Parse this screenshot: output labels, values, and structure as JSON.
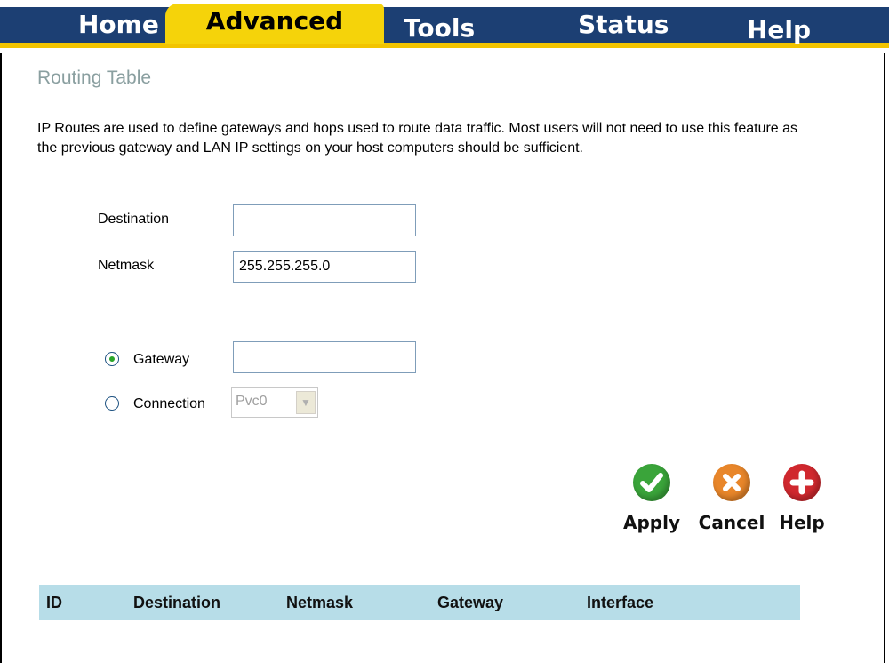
{
  "tabs": [
    {
      "label": "Home",
      "active": false
    },
    {
      "label": "Advanced",
      "active": true
    },
    {
      "label": "Tools",
      "active": false
    },
    {
      "label": "Status",
      "active": false
    },
    {
      "label": "Help",
      "active": false
    }
  ],
  "colors": {
    "nav": "#1c3f73",
    "accent": "#f5d30a",
    "table_header": "#b7dde8",
    "title": "#8a9fa0"
  },
  "page": {
    "title": "Routing Table",
    "intro": "IP Routes are used to define gateways and hops used to route data traffic. Most users will not need to use this feature as the previous gateway and LAN IP settings on your host computers should be sufficient."
  },
  "form": {
    "destination_label": "Destination",
    "destination_value": "",
    "netmask_label": "Netmask",
    "netmask_value": "255.255.255.0",
    "gateway_label": "Gateway",
    "gateway_value": "",
    "gateway_selected": true,
    "connection_label": "Connection",
    "connection_selected": false,
    "connection_value": "Pvc0"
  },
  "actions": {
    "apply": {
      "label": "Apply",
      "icon": "checkmark-icon"
    },
    "cancel": {
      "label": "Cancel",
      "icon": "x-icon"
    },
    "help": {
      "label": "Help",
      "icon": "plus-icon"
    }
  },
  "table": {
    "columns": [
      "ID",
      "Destination",
      "Netmask",
      "Gateway",
      "Interface"
    ],
    "rows": []
  }
}
